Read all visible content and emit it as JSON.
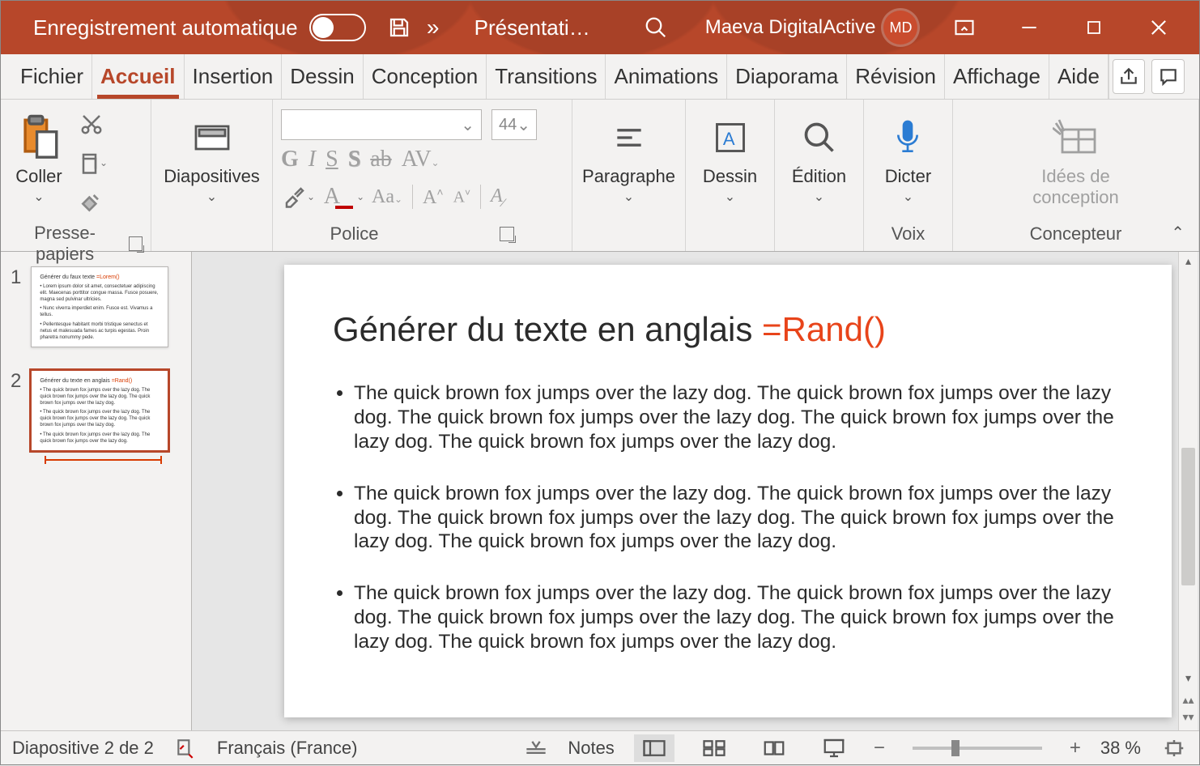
{
  "titlebar": {
    "autosave_label": "Enregistrement automatique",
    "doc_title": "Présentati…",
    "user_name": "Maeva DigitalActive",
    "user_initials": "MD"
  },
  "tabs": {
    "items": [
      "Fichier",
      "Accueil",
      "Insertion",
      "Dessin",
      "Conception",
      "Transitions",
      "Animations",
      "Diaporama",
      "Révision",
      "Affichage",
      "Aide"
    ],
    "active_index": 1
  },
  "ribbon": {
    "paste_label": "Coller",
    "clipboard_label": "Presse-papiers",
    "slides_label": "Diapositives",
    "font_label": "Police",
    "font_size": "44",
    "paragraph_label": "Paragraphe",
    "drawing_label": "Dessin",
    "editing_label": "Édition",
    "dictate_label": "Dicter",
    "voice_label": "Voix",
    "designer_label1": "Idées de",
    "designer_label2": "conception",
    "designer_group": "Concepteur"
  },
  "thumbnails": [
    {
      "num": "1",
      "title_a": "Générer du faux texte ",
      "title_b": "=Lorem()"
    },
    {
      "num": "2",
      "title_a": "Générer du texte en anglais ",
      "title_b": "=Rand()"
    }
  ],
  "slide": {
    "title_a": "Générer du texte en anglais ",
    "title_b": "=Rand()",
    "bullets": [
      "The quick brown fox jumps over the lazy dog. The quick brown fox jumps over the lazy dog. The quick brown fox jumps over the lazy dog. The quick brown fox jumps over the lazy dog. The quick brown fox jumps over the lazy dog.",
      "The quick brown fox jumps over the lazy dog. The quick brown fox jumps over the lazy dog. The quick brown fox jumps over the lazy dog. The quick brown fox jumps over the lazy dog. The quick brown fox jumps over the lazy dog.",
      "The quick brown fox jumps over the lazy dog. The quick brown fox jumps over the lazy dog. The quick brown fox jumps over the lazy dog. The quick brown fox jumps over the lazy dog. The quick brown fox jumps over the lazy dog."
    ]
  },
  "status": {
    "slide_count": "Diapositive 2 de 2",
    "language": "Français (France)",
    "notes_label": "Notes",
    "zoom_pct": "38 %"
  }
}
